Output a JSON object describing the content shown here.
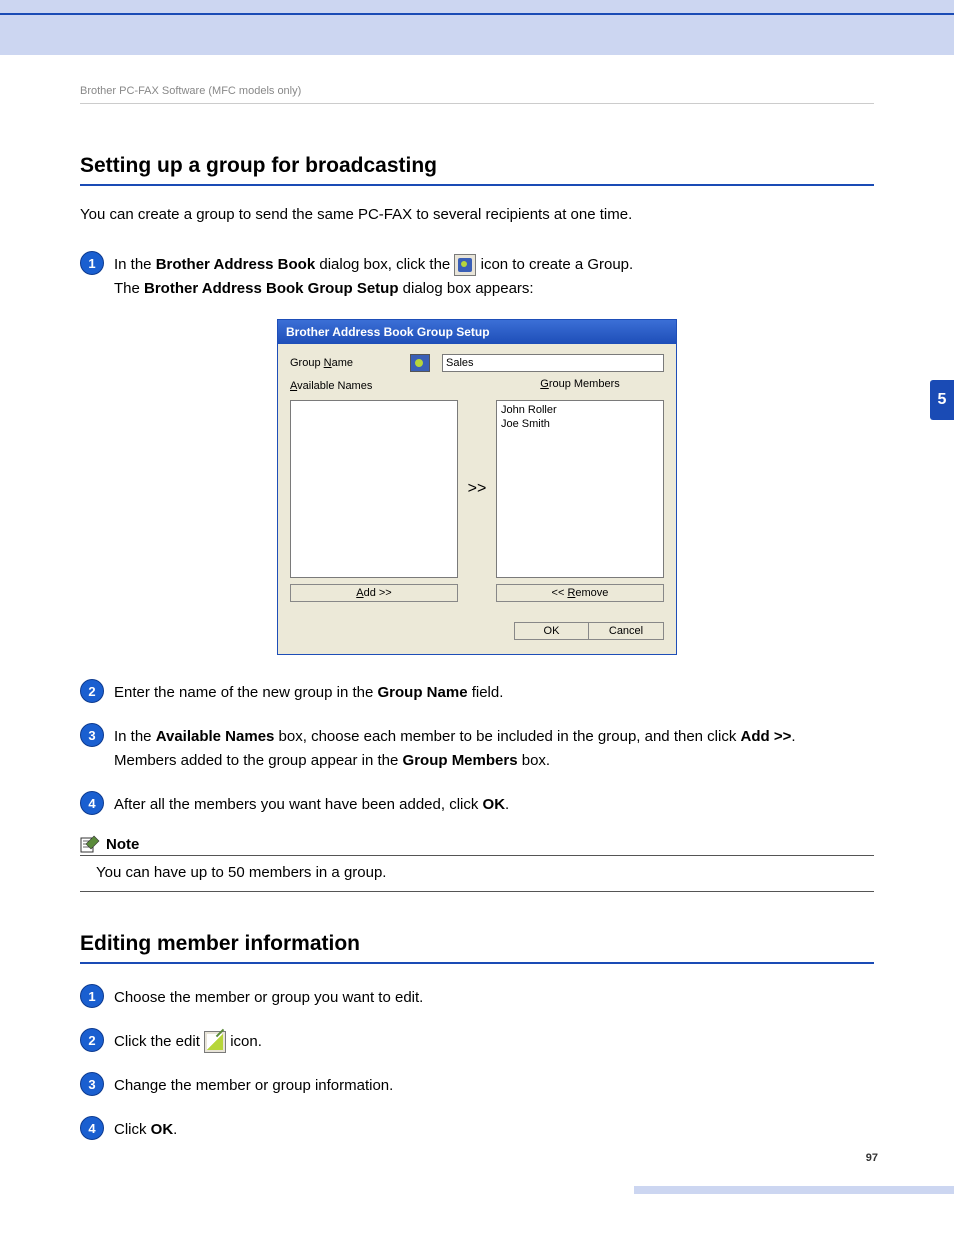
{
  "page": {
    "header": "Brother PC-FAX Software (MFC models only)",
    "chapter_tab": "5",
    "page_number": "97"
  },
  "section1": {
    "heading": "Setting up a group for broadcasting",
    "intro": "You can create a group to send the same PC-FAX to several recipients at one time.",
    "step1": {
      "p1a": "In the ",
      "p1b": "Brother Address Book",
      "p1c": " dialog box, click the ",
      "p1d": " icon to create a Group.",
      "p2a": "The ",
      "p2b": "Brother Address Book Group Setup",
      "p2c": " dialog box appears:"
    },
    "step2": {
      "a": "Enter the name of the new group in the ",
      "b": "Group Name",
      "c": " field."
    },
    "step3": {
      "a": "In the ",
      "b": "Available Names",
      "c": " box, choose each member to be included in the group, and then click ",
      "d": "Add >>",
      "e": ".",
      "f": "Members added to the group appear in the ",
      "g": "Group Members",
      "h": " box."
    },
    "step4": {
      "a": "After all the members you want have been added, click ",
      "b": "OK",
      "c": "."
    },
    "note": {
      "label": "Note",
      "body": "You can have up to 50 members in a group."
    }
  },
  "dialog": {
    "title": "Brother Address Book Group Setup",
    "group_name_label_pre": "Group ",
    "group_name_label_u": "N",
    "group_name_label_post": "ame",
    "group_name_value": "Sales",
    "available_label_pre": "A",
    "available_label_u": "v",
    "available_label_post": "ailable Names",
    "members_label_u": "G",
    "members_label_post": "roup Members",
    "member1": "John Roller",
    "member2": "Joe Smith",
    "arrow": ">>",
    "add_btn_u": "A",
    "add_btn_post": "dd >>",
    "remove_btn_pre": "<< ",
    "remove_btn_u": "R",
    "remove_btn_post": "emove",
    "ok": "OK",
    "cancel": "Cancel"
  },
  "section2": {
    "heading": "Editing member information",
    "step1": "Choose the member or group you want to edit.",
    "step2a": "Click the edit ",
    "step2b": " icon.",
    "step3": "Change the member or group information.",
    "step4a": "Click ",
    "step4b": "OK",
    "step4c": "."
  }
}
